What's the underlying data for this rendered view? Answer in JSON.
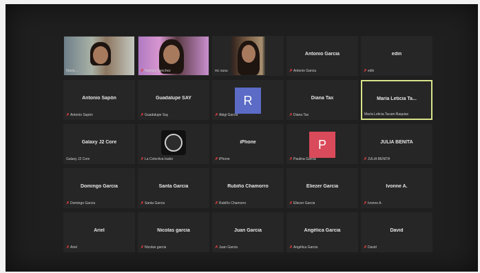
{
  "colors": {
    "avatar_r": "#5b6bc6",
    "avatar_p": "#d94a5a",
    "active_border": "#d8e48a"
  },
  "participants": [
    {
      "name": "",
      "label": "Maria ...",
      "video": true
    },
    {
      "name": "",
      "label": "Nathaly Sanchez",
      "video": true
    },
    {
      "name": "",
      "label": "mc susu",
      "video": true
    },
    {
      "name": "Antonio Garcia",
      "label": "Antonio Garcia"
    },
    {
      "name": "edin",
      "label": "edin"
    },
    {
      "name": "Antonio Sapón",
      "label": "Antonio Sapón"
    },
    {
      "name": "Guadalupe SAY",
      "label": "Guadalupe Say"
    },
    {
      "name": "",
      "label": "Abigi Garcia",
      "avatar": "R"
    },
    {
      "name": "Diana Tax",
      "label": "Diana Tax"
    },
    {
      "name": "María Leticia Ta...",
      "label": "María Leticia Tacam Baquiax"
    },
    {
      "name": "Galaxy J2 Core",
      "label": "Galaxy J2 Core"
    },
    {
      "name": "",
      "label": "La Colectiva Isabo",
      "logo": true
    },
    {
      "name": "iPhone",
      "label": "iPhone"
    },
    {
      "name": "",
      "label": "Paulina Garcia",
      "avatar": "P"
    },
    {
      "name": "JULIA BENITA",
      "label": "JULIA BENITA"
    },
    {
      "name": "Domingo Garcia",
      "label": "Domingo Garcia"
    },
    {
      "name": "Santa Garcia",
      "label": "Santa Garcia"
    },
    {
      "name": "Rubiño Chamorro",
      "label": "Rubiño Chamorro"
    },
    {
      "name": "Eliezer Garcia",
      "label": "Eliezer Garcia"
    },
    {
      "name": "Ivonne A.",
      "label": "Ivonne A."
    },
    {
      "name": "Ariel",
      "label": "Ariel"
    },
    {
      "name": "Nicolas garcia",
      "label": "Nicolas garcia"
    },
    {
      "name": "Juan Garcia",
      "label": "Juan Garcia"
    },
    {
      "name": "Angélica Garcia",
      "label": "Angélica Garcia"
    },
    {
      "name": "David",
      "label": "David"
    }
  ]
}
